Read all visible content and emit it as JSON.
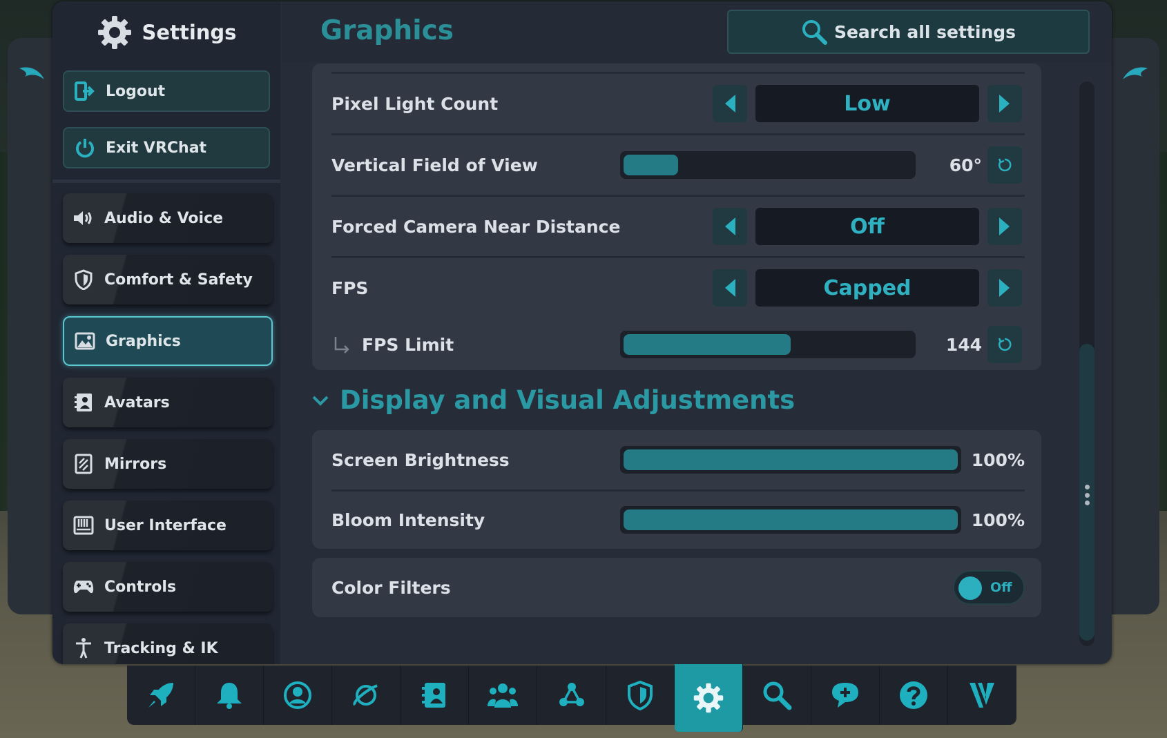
{
  "colors": {
    "accent": "#2fb1c2",
    "accent_dark": "#247a85",
    "panel": "#323844",
    "window": "#262d38"
  },
  "sidebar": {
    "title": "Settings",
    "buttons": [
      {
        "label": "Logout",
        "icon": "logout-icon"
      },
      {
        "label": "Exit VRChat",
        "icon": "power-icon"
      }
    ],
    "items": [
      {
        "label": "Audio & Voice",
        "icon": "speaker-icon"
      },
      {
        "label": "Comfort & Safety",
        "icon": "shield-icon"
      },
      {
        "label": "Graphics",
        "icon": "image-icon",
        "active": true
      },
      {
        "label": "Avatars",
        "icon": "avatar-icon"
      },
      {
        "label": "Mirrors",
        "icon": "mirror-icon"
      },
      {
        "label": "User Interface",
        "icon": "keyboard-icon"
      },
      {
        "label": "Controls",
        "icon": "gamepad-icon"
      },
      {
        "label": "Tracking & IK",
        "icon": "person-icon"
      }
    ]
  },
  "header": {
    "title": "Graphics",
    "search_label": "Search all settings"
  },
  "settings": {
    "pixel_light_count": {
      "label": "Pixel Light Count",
      "value": "Low"
    },
    "vertical_fov": {
      "label": "Vertical Field of View",
      "value": "60°",
      "fraction": 0.19
    },
    "forced_camera_near": {
      "label": "Forced Camera Near Distance",
      "value": "Off"
    },
    "fps": {
      "label": "FPS",
      "value": "Capped"
    },
    "fps_limit": {
      "label": "FPS Limit",
      "value": "144",
      "fraction": 0.58
    }
  },
  "display_section": {
    "title": "Display and Visual Adjustments",
    "screen_brightness": {
      "label": "Screen Brightness",
      "value": "100%",
      "fraction": 1.0
    },
    "bloom_intensity": {
      "label": "Bloom Intensity",
      "value": "100%",
      "fraction": 1.0
    },
    "color_filters": {
      "label": "Color Filters",
      "state": "Off"
    }
  },
  "dock": {
    "items": [
      {
        "icon": "rocket-icon"
      },
      {
        "icon": "bell-icon"
      },
      {
        "icon": "profile-icon"
      },
      {
        "icon": "planet-icon"
      },
      {
        "icon": "avatar-card-icon"
      },
      {
        "icon": "group-icon"
      },
      {
        "icon": "network-icon"
      },
      {
        "icon": "shield-icon"
      },
      {
        "icon": "gear-icon",
        "active": true
      },
      {
        "icon": "search-icon"
      },
      {
        "icon": "chat-add-icon"
      },
      {
        "icon": "help-icon"
      },
      {
        "icon": "vrchat-logo-icon"
      }
    ]
  }
}
